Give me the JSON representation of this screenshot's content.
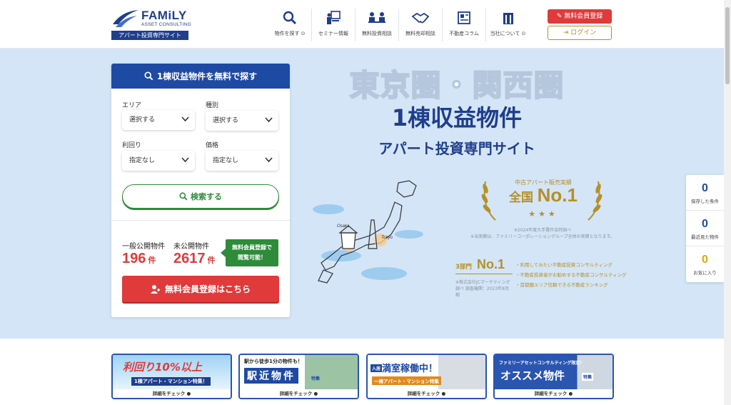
{
  "brand": {
    "name": "FAMiLY",
    "tagline": "ASSET CONSULTING",
    "band": "アパート投資専門サイト",
    "primary_color": "#1f3e8c",
    "accent_red": "#e03a3a",
    "accent_green": "#2e8b3a",
    "accent_gold": "#b49028"
  },
  "nav": {
    "items": [
      {
        "label": "物件を探す ⊙",
        "icon": "search-icon"
      },
      {
        "label": "セミナー情報",
        "icon": "seminar-icon"
      },
      {
        "label": "無料投資相談",
        "icon": "consultation-icon"
      },
      {
        "label": "無料売却相談",
        "icon": "handshake-icon"
      },
      {
        "label": "不動産コラム",
        "icon": "column-icon"
      },
      {
        "label": "当社について ⊙",
        "icon": "building-icon"
      }
    ],
    "register": "無料会員登録",
    "login": "ログイン"
  },
  "search": {
    "title": "1棟収益物件を無料で探す",
    "area_label": "エリア",
    "area_value": "選択する",
    "type_label": "種別",
    "type_value": "選択する",
    "yield_label": "利回り",
    "yield_value": "指定なし",
    "price_label": "価格",
    "price_value": "指定なし",
    "button": "検索する",
    "public_label": "一般公開物件",
    "public_count": "196",
    "private_label": "未公開物件",
    "private_count": "2617",
    "unit": "件",
    "badge_line1": "無料会員登録で",
    "badge_line2": "閲覧可能！",
    "register_button": "無料会員登録はこちら"
  },
  "hero": {
    "title": "東京圏・関西圏",
    "subtitle": "1棟収益物件",
    "subtitle2": "アパート投資専門サイト",
    "map_label_osaka": "Osaka",
    "map_label_tokyo": "Tokyo",
    "award_caption": "中古アパート販売実績",
    "award_region": "全国",
    "award_rank": "No.1",
    "award_note_1": "※2024年度大手署作会特調べ",
    "award_note_2": "※当実績は、ファミリーコーポレーショングループ全体の実績となります。",
    "award3_label": "3部門",
    "award3_rank": "No.1",
    "award3_items": [
      "・利用してみたい不動産投資コンサルティング",
      "・不動産投資者がお勧めする不動産コンサルティング",
      "・首都圏エリア信頼できる不動産ランキング"
    ],
    "award3_note": "※株式会社JCマーケティング調べ 調査機関：2023年8月期"
  },
  "side": {
    "items": [
      {
        "count": "0",
        "label": "保存した条件",
        "color": "#1f4aa3"
      },
      {
        "count": "0",
        "label": "最近見た物件",
        "color": "#1f4aa3"
      },
      {
        "count": "0",
        "label": "お気に入り",
        "color": "#e0a800"
      }
    ]
  },
  "banners": [
    {
      "line1": "利回り10%以上",
      "line2": "1棟アパート・マンション特集！",
      "footer": "詳細をチェック ●"
    },
    {
      "line1": "駅から徒歩1分の物件も！",
      "line2": "駅近物件",
      "tag": "特集",
      "footer": "詳細をチェック ●"
    },
    {
      "line1": "満室稼働中！",
      "line2": "一棟アパート・マンション特集",
      "tag": "入居",
      "footer": "詳細をチェック ●"
    },
    {
      "line1": "ファミリーアセットコンサルティング限定！",
      "line2": "オススメ物件",
      "tag": "特集",
      "footer": "詳細をチェック ●"
    }
  ]
}
